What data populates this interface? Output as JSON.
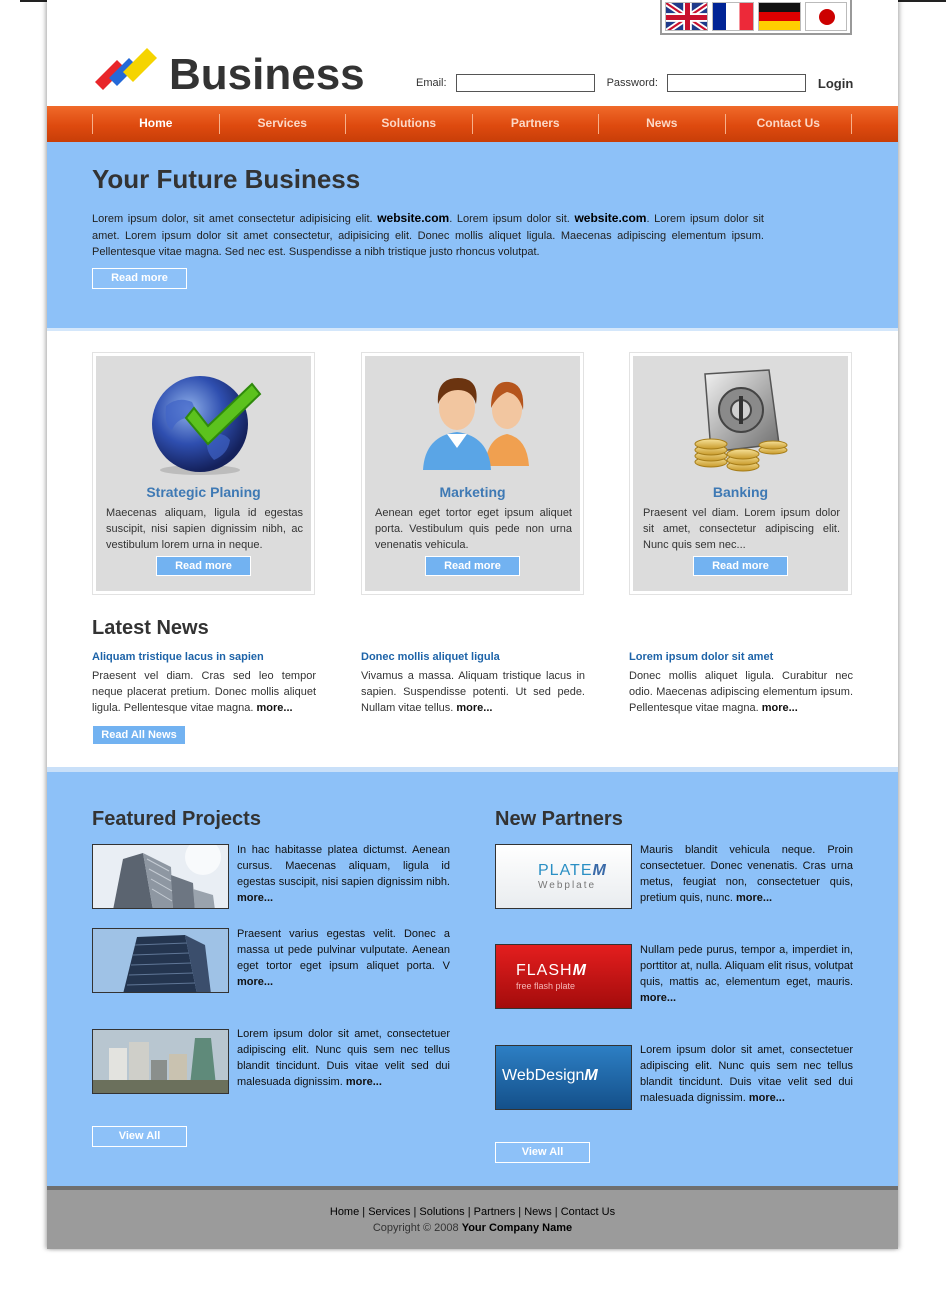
{
  "brand": {
    "name": "Business",
    "logo_colors": [
      "#e8262a",
      "#2469d8",
      "#f5d400"
    ]
  },
  "languages": [
    "english-flag-icon",
    "french-flag-icon",
    "german-flag-icon",
    "japanese-flag-icon"
  ],
  "login": {
    "email_label": "Email:",
    "password_label": "Password:",
    "email_value": "",
    "password_value": "",
    "button": "Login"
  },
  "nav": {
    "items": [
      "Home",
      "Services",
      "Solutions",
      "Partners",
      "News",
      "Contact Us"
    ],
    "active": "Home"
  },
  "hero": {
    "title": "Your Future Business",
    "text_1": "Lorem ipsum dolor, sit amet consectetur adipisicing elit. ",
    "bold_1": "website.com",
    "text_2": ". Lorem ipsum dolor sit. ",
    "bold_2": "website.com",
    "text_3": ". Lorem ipsum dolor sit amet. Lorem ipsum dolor sit amet consectetur, adipisicing elit. Donec mollis aliquet ligula. Maecenas adipiscing elementum ipsum. Pellentesque vitae magna. Sed nec est. Suspendisse a nibh tristique justo rhoncus volutpat.",
    "button": "Read more"
  },
  "services": [
    {
      "icon": "globe-checkmark-icon",
      "title": "Strategic Planing",
      "text": "Maecenas aliquam, ligula id egestas suscipit, nisi sapien dignissim nibh, ac vestibulum lorem urna in neque.",
      "button": "Read more"
    },
    {
      "icon": "people-icon",
      "title": "Marketing",
      "text": "Aenean eget tortor eget ipsum aliquet porta. Vestibulum quis pede non urna venenatis vehicula.",
      "button": "Read more"
    },
    {
      "icon": "safe-coins-icon",
      "title": "Banking",
      "text": "Praesent vel diam. Lorem ipsum dolor sit amet, consectetur adipiscing elit. Nunc quis sem nec...",
      "button": "Read more"
    }
  ],
  "news": {
    "title": "Latest News",
    "items": [
      {
        "head": "Aliquam tristique lacus in sapien",
        "text": "Praesent vel diam. Cras sed leo tempor neque placerat pretium. Donec mollis aliquet ligula. Pellentesque vitae magna. ",
        "more": "more..."
      },
      {
        "head": "Donec mollis aliquet ligula",
        "text": "Vivamus a massa. Aliquam tristique lacus in sapien. Suspendisse potenti. Ut sed pede. Nullam vitae tellus. ",
        "more": "more..."
      },
      {
        "head": "Lorem ipsum dolor sit amet",
        "text": "Donec mollis aliquet ligula. Curabitur nec odio. Maecenas adipiscing elementum ipsum. Pellentesque vitae magna. ",
        "more": "more..."
      }
    ],
    "button": "Read All News"
  },
  "projects": {
    "title": "Featured Projects",
    "items": [
      {
        "image": "skyscraper-photo",
        "text": "In hac habitasse platea dictumst. Aenean cursus. Maecenas aliquam, ligula id egestas suscipit, nisi sapien dignissim nibh. ",
        "more": "more..."
      },
      {
        "image": "office-tower-photo",
        "text": "Praesent varius egestas velit. Donec a massa ut pede pulvinar vulputate. Aenean eget tortor eget ipsum aliquet porta. V ",
        "more": "more..."
      },
      {
        "image": "city-skyline-photo",
        "text": "Lorem ipsum dolor sit amet, consectetuer adipiscing elit. Nunc quis sem nec tellus blandit tincidunt. Duis vitae velit sed dui malesuada dignissim. ",
        "more": "more..."
      }
    ],
    "button": "View All"
  },
  "partners": {
    "title": "New Partners",
    "items": [
      {
        "logo_main": "PLATE",
        "logo_mark": "M",
        "logo_sub": "Webplate",
        "text": "Mauris blandit vehicula neque. Proin consectetuer. Donec venenatis. Cras urna metus, feugiat non, consectetuer quis, pretium quis, nunc. ",
        "more": "more..."
      },
      {
        "logo_main": "FLASH",
        "logo_mark": "M",
        "logo_sub": "free flash plate",
        "text": "Nullam pede purus, tempor a, imperdiet in, porttitor at, nulla. Aliquam elit risus, volutpat quis, mattis ac, elementum eget, mauris. ",
        "more": "more..."
      },
      {
        "logo_main": "WebDesign",
        "logo_mark": "M",
        "logo_sub": "",
        "text": "Lorem ipsum dolor sit amet, consectetuer adipiscing elit. Nunc quis sem nec tellus blandit tincidunt. Duis vitae velit sed dui malesuada dignissim. ",
        "more": "more..."
      }
    ],
    "button": "View All"
  },
  "footer": {
    "links": [
      "Home",
      "Services",
      "Solutions",
      "Partners",
      "News",
      "Contact Us"
    ],
    "copyright": "Copyright © 2008 ",
    "company": "Your Company Name"
  },
  "colors": {
    "nav_orange": "#de4a0f",
    "hero_blue": "#8dc1f8",
    "button_blue": "#72b2f1",
    "link_blue": "#1d63a8",
    "footer_gray": "#9b9b9b"
  }
}
